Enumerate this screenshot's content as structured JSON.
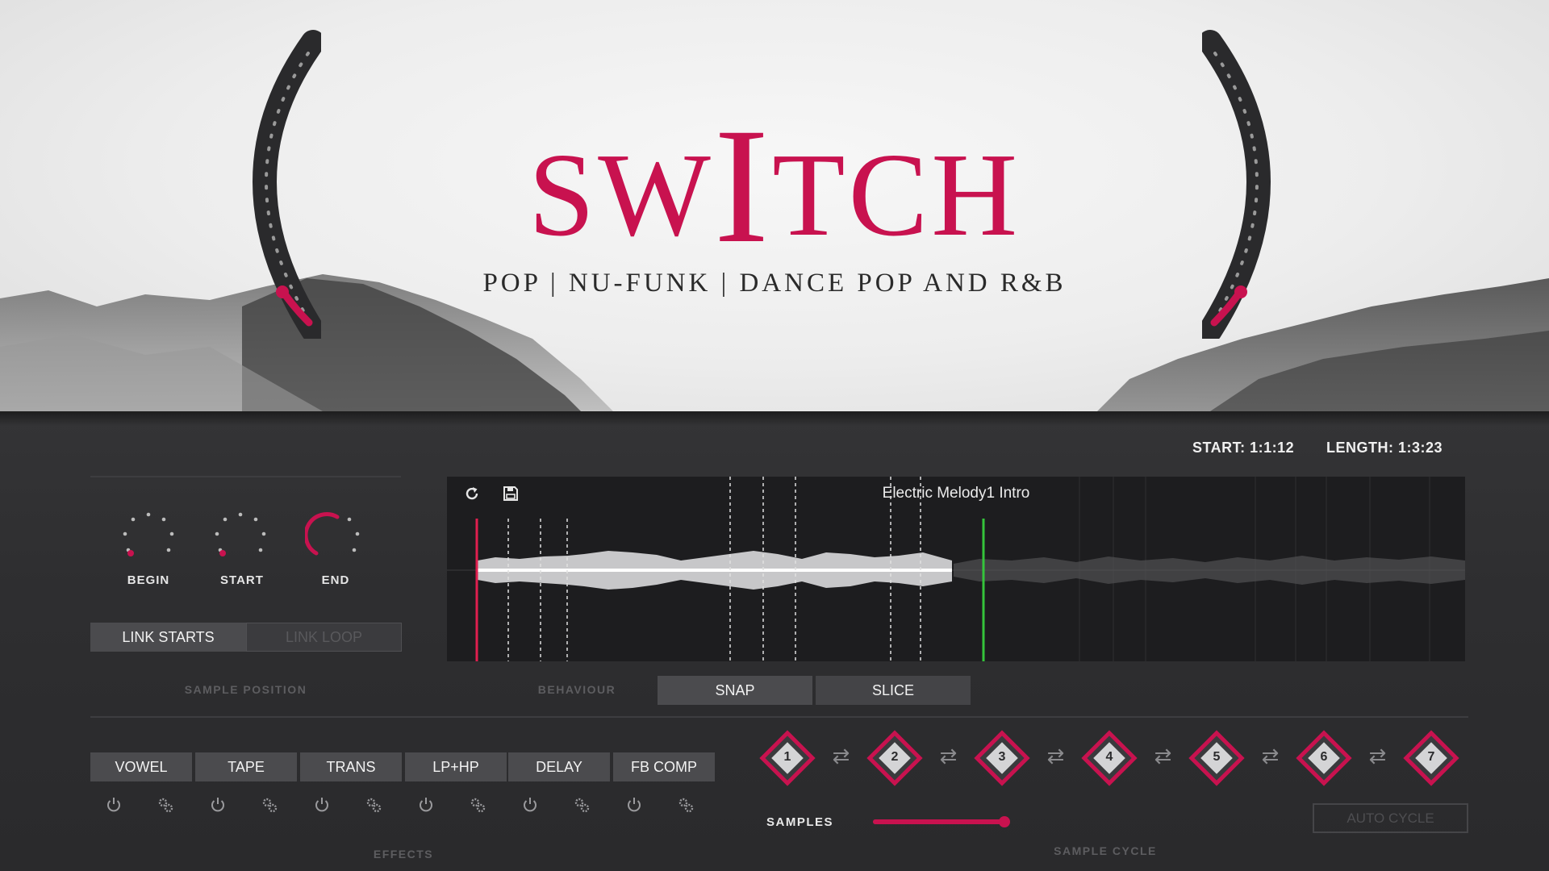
{
  "header": {
    "logo": {
      "pre": "SW",
      "tall": "I",
      "post": "TCH"
    },
    "subtitle": "POP | NU-FUNK | DANCE POP AND R&B",
    "accent_color": "#c8124f",
    "left_dial_level": 0.02,
    "right_dial_level": 0.02
  },
  "transport": {
    "start": "START: 1:1:12",
    "length": "LENGTH: 1:3:23"
  },
  "sample_position": {
    "section_label": "SAMPLE POSITION",
    "knobs": [
      {
        "label": "BEGIN",
        "level": 0.0
      },
      {
        "label": "START",
        "level": 0.0
      },
      {
        "label": "END",
        "level": 0.55
      }
    ],
    "link_starts": "LINK STARTS",
    "link_loop": "LINK LOOP"
  },
  "waveform": {
    "title": "Electric Melody1 Intro",
    "refresh_icon": "refresh-icon",
    "save_icon": "save-icon",
    "start_marker_color": "#e01f4f",
    "end_marker_color": "#35c43b"
  },
  "behaviour": {
    "section_label": "BEHAVIOUR",
    "snap": "SNAP",
    "slice": "SLICE"
  },
  "effects": {
    "section_label": "EFFECTS",
    "items": [
      "VOWEL",
      "TAPE",
      "TRANS",
      "LP+HP",
      "DELAY",
      "FB COMP"
    ],
    "power_icon": "power-icon",
    "settings_icon": "gears-icon"
  },
  "sample_cycle": {
    "section_label": "SAMPLE CYCLE",
    "slots": [
      "1",
      "2",
      "3",
      "4",
      "5",
      "6",
      "7"
    ],
    "swap_icon": "swap-arrows-icon",
    "samples_label": "SAMPLES",
    "samples_level": 0.98,
    "auto_cycle": "AUTO CYCLE"
  }
}
